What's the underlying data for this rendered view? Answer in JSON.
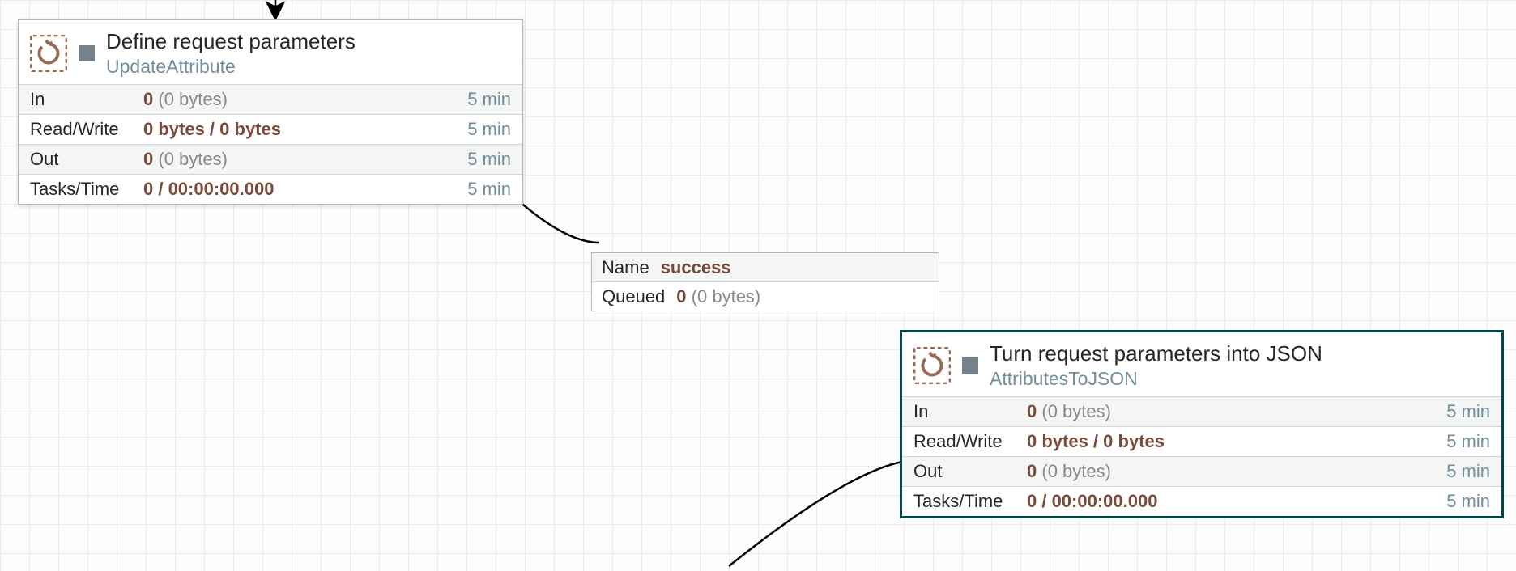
{
  "processors": [
    {
      "id": "p1",
      "title": "Define request parameters",
      "type": "UpdateAttribute",
      "stats": {
        "in": {
          "label": "In",
          "strong": "0",
          "light": "(0 bytes)",
          "time": "5 min"
        },
        "rw": {
          "label": "Read/Write",
          "strong": "0 bytes / 0 bytes",
          "light": "",
          "time": "5 min"
        },
        "out": {
          "label": "Out",
          "strong": "0",
          "light": "(0 bytes)",
          "time": "5 min"
        },
        "tt": {
          "label": "Tasks/Time",
          "strong": "0 / 00:00:00.000",
          "light": "",
          "time": "5 min"
        }
      }
    },
    {
      "id": "p2",
      "title": "Turn request parameters into JSON",
      "type": "AttributesToJSON",
      "stats": {
        "in": {
          "label": "In",
          "strong": "0",
          "light": "(0 bytes)",
          "time": "5 min"
        },
        "rw": {
          "label": "Read/Write",
          "strong": "0 bytes / 0 bytes",
          "light": "",
          "time": "5 min"
        },
        "out": {
          "label": "Out",
          "strong": "0",
          "light": "(0 bytes)",
          "time": "5 min"
        },
        "tt": {
          "label": "Tasks/Time",
          "strong": "0 / 00:00:00.000",
          "light": "",
          "time": "5 min"
        }
      }
    }
  ],
  "connection": {
    "nameLabel": "Name",
    "name": "success",
    "queuedLabel": "Queued",
    "queuedStrong": "0",
    "queuedLight": "(0 bytes)"
  }
}
